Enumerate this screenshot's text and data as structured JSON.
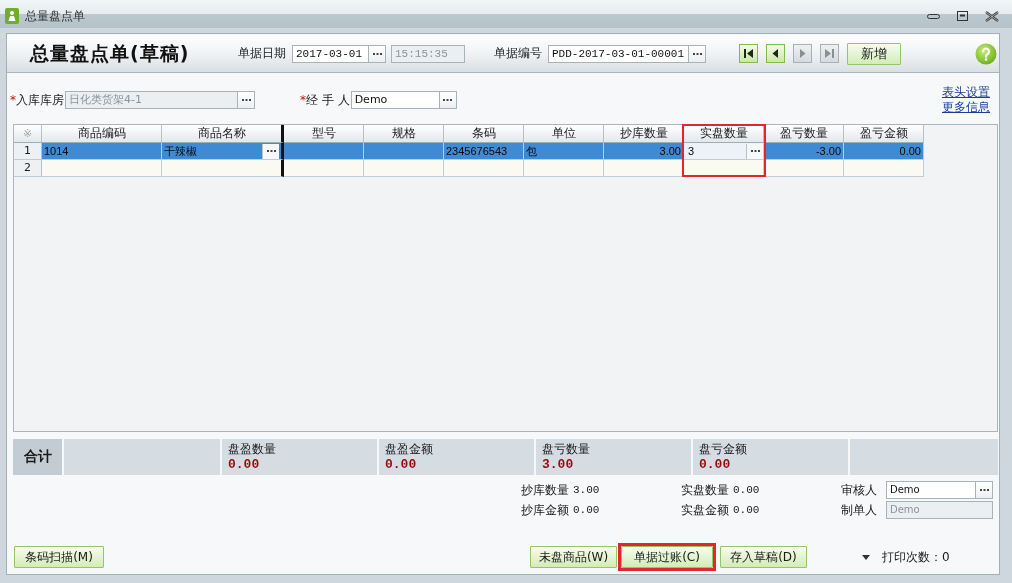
{
  "window": {
    "title": "总量盘点单"
  },
  "header": {
    "title": "总量盘点单(草稿)",
    "fields": [
      {
        "label": "单据日期",
        "value": "2017-03-01",
        "has_picker": true,
        "disabled": false
      },
      {
        "value": "15:15:35",
        "has_picker": false,
        "disabled": true
      },
      {
        "label": "单据编号",
        "value": "PDD-2017-03-01-00001",
        "has_picker": true,
        "disabled": false
      }
    ],
    "nav_buttons": [
      {
        "kind": "first",
        "disabled": false
      },
      {
        "kind": "previous",
        "disabled": false
      },
      {
        "kind": "next",
        "disabled": true
      },
      {
        "kind": "last",
        "disabled": true
      }
    ],
    "new_button": "新增"
  },
  "form": {
    "fields": [
      {
        "required_mark": "*",
        "label": "入库库房",
        "value": "日化类货架4-1",
        "has_picker": true,
        "disabled": true
      },
      {
        "required_mark": "*",
        "label": "经 手 人",
        "value": "Demo",
        "has_picker": true,
        "disabled": false
      }
    ],
    "links": [
      "表头设置",
      "更多信息"
    ]
  },
  "table": {
    "corner": "※",
    "columns": [
      {
        "label": "商品编码",
        "kind": "text",
        "frozen_divider": false,
        "has_picker": false,
        "editing": false,
        "highlighted": false
      },
      {
        "label": "商品名称",
        "kind": "text",
        "frozen_divider": true,
        "has_picker": true,
        "editing": false,
        "highlighted": false
      },
      {
        "label": "型号",
        "kind": "text",
        "frozen_divider": false,
        "has_picker": false,
        "editing": false,
        "highlighted": false
      },
      {
        "label": "规格",
        "kind": "text",
        "frozen_divider": false,
        "has_picker": false,
        "editing": false,
        "highlighted": false
      },
      {
        "label": "条码",
        "kind": "text",
        "frozen_divider": false,
        "has_picker": false,
        "editing": false,
        "highlighted": false
      },
      {
        "label": "单位",
        "kind": "text",
        "frozen_divider": false,
        "has_picker": false,
        "editing": false,
        "highlighted": false
      },
      {
        "label": "抄库数量",
        "kind": "number",
        "frozen_divider": false,
        "has_picker": false,
        "editing": false,
        "highlighted": false
      },
      {
        "label": "实盘数量",
        "kind": "number",
        "frozen_divider": false,
        "has_picker": true,
        "editing": true,
        "highlighted": true
      },
      {
        "label": "盈亏数量",
        "kind": "number",
        "frozen_divider": false,
        "has_picker": false,
        "editing": false,
        "highlighted": false
      },
      {
        "label": "盈亏金额",
        "kind": "number",
        "frozen_divider": false,
        "has_picker": false,
        "editing": false,
        "highlighted": false
      }
    ],
    "rows": [
      {
        "number": "1",
        "selected": true,
        "cells": [
          "1014",
          "干辣椒",
          null,
          null,
          "2345676543",
          "包",
          "3.00",
          "3",
          "-3.00",
          "0.00"
        ]
      },
      {
        "number": "2",
        "selected": false
      }
    ]
  },
  "totals": {
    "label": "合计",
    "metrics": [
      {
        "label": "盘盈数量",
        "value": "0.00"
      },
      {
        "label": "盘盈金额",
        "value": "0.00"
      },
      {
        "label": "盘亏数量",
        "value": "3.00"
      },
      {
        "label": "盘亏金额",
        "value": "0.00"
      }
    ]
  },
  "summary": [
    {
      "kind": "stat",
      "label": "抄库数量",
      "value": "3.00"
    },
    {
      "kind": "stat",
      "label": "实盘数量",
      "value": "0.00"
    },
    {
      "kind": "signer",
      "label": "审核人",
      "value": "Demo",
      "has_picker": true,
      "disabled": false
    },
    {
      "kind": "stat",
      "label": "抄库金额",
      "value": "0.00"
    },
    {
      "kind": "stat",
      "label": "实盘金额",
      "value": "0.00"
    },
    {
      "kind": "signer",
      "label": "制单人",
      "value": "Demo",
      "has_picker": false,
      "disabled": true
    }
  ],
  "footer": {
    "left_buttons": [
      {
        "label": "条码扫描(M)",
        "highlighted": false
      }
    ],
    "right_buttons": [
      {
        "label": "未盘商品(W)",
        "highlighted": false
      },
      {
        "label": "单据过账(C)",
        "highlighted": true
      },
      {
        "label": "存入草稿(D)",
        "highlighted": false
      }
    ],
    "print_count": "打印次数：0"
  }
}
